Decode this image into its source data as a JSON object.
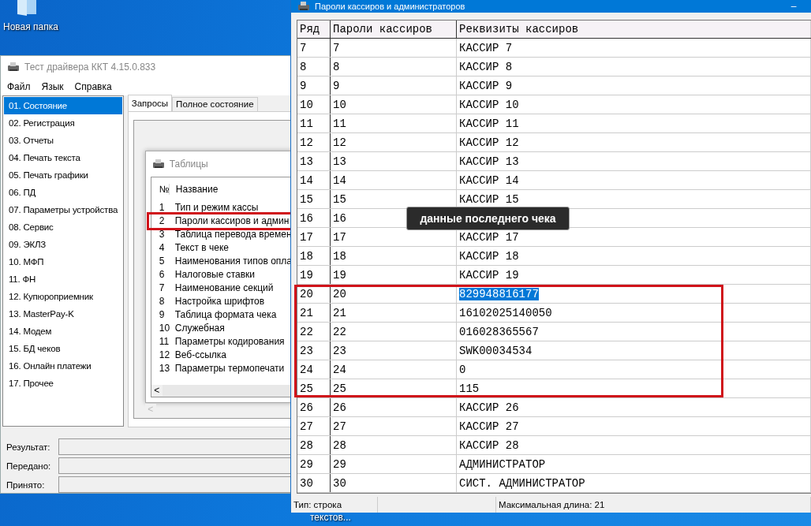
{
  "desktop": {
    "icons": [
      {
        "label": "Новая папка"
      },
      {
        "label": "текстов..."
      }
    ]
  },
  "main_window": {
    "title": "Тест драйвера ККТ 4.15.0.833",
    "menu": [
      "Файл",
      "Язык",
      "Справка"
    ],
    "sidebar": [
      {
        "label": "01. Состояние",
        "selected": true
      },
      {
        "label": "02. Регистрация",
        "selected": false
      },
      {
        "label": "03. Отчеты",
        "selected": false
      },
      {
        "label": "04. Печать текста",
        "selected": false
      },
      {
        "label": "05. Печать графики",
        "selected": false
      },
      {
        "label": "06. ПД",
        "selected": false
      },
      {
        "label": "07. Параметры устройства",
        "selected": false
      },
      {
        "label": "08. Сервис",
        "selected": false
      },
      {
        "label": "09. ЭКЛЗ",
        "selected": false
      },
      {
        "label": "10. МФП",
        "selected": false
      },
      {
        "label": "11. ФН",
        "selected": false
      },
      {
        "label": "12. Купюроприемник",
        "selected": false
      },
      {
        "label": "13. MasterPay-K",
        "selected": false
      },
      {
        "label": "14. Модем",
        "selected": false
      },
      {
        "label": "15. БД чеков",
        "selected": false
      },
      {
        "label": "16. Онлайн платежи",
        "selected": false
      },
      {
        "label": "17. Прочее",
        "selected": false
      }
    ],
    "tabs": [
      {
        "label": "Запросы",
        "selected": true
      },
      {
        "label": "Полное состояние",
        "selected": false
      }
    ],
    "tables_dialog": {
      "title": "Таблицы",
      "columns": [
        "№",
        "Название"
      ],
      "rows": [
        {
          "number": "1",
          "name": "Тип и режим кассы",
          "marked": false
        },
        {
          "number": "2",
          "name": "Пароли кассиров и админ",
          "marked": true
        },
        {
          "number": "3",
          "name": "Таблица перевода времен",
          "marked": false
        },
        {
          "number": "4",
          "name": "Текст в чеке",
          "marked": false
        },
        {
          "number": "5",
          "name": "Наименования типов опла",
          "marked": false
        },
        {
          "number": "6",
          "name": "Налоговые ставки",
          "marked": false
        },
        {
          "number": "7",
          "name": "Наименование секций",
          "marked": false
        },
        {
          "number": "8",
          "name": "Настройка шрифтов",
          "marked": false
        },
        {
          "number": "9",
          "name": "Таблица формата чека",
          "marked": false
        },
        {
          "number": "10",
          "name": "Служебная",
          "marked": false
        },
        {
          "number": "11",
          "name": "Параметры кодирования",
          "marked": false
        },
        {
          "number": "12",
          "name": "Веб-ссылка",
          "marked": false
        },
        {
          "number": "13",
          "name": "Параметры термопечати",
          "marked": false
        }
      ],
      "scroll_arrow": "<"
    },
    "panel_scroll_arrow": "<",
    "status_fields": [
      {
        "label": "Результат:"
      },
      {
        "label": "Передано:"
      },
      {
        "label": "Принято:"
      }
    ]
  },
  "tooltip": {
    "text": "данные последнего чека"
  },
  "passwords_window": {
    "title": "Пароли кассиров и администраторов",
    "minimize": "–",
    "columns": [
      "Ряд",
      "Пароли кассиров",
      "Реквизиты кассиров"
    ],
    "rows": [
      {
        "row": "7",
        "password": "7",
        "details": "КАССИР 7",
        "selected": false,
        "marked": false
      },
      {
        "row": "8",
        "password": "8",
        "details": "КАССИР 8",
        "selected": false,
        "marked": false
      },
      {
        "row": "9",
        "password": "9",
        "details": "КАССИР 9",
        "selected": false,
        "marked": false
      },
      {
        "row": "10",
        "password": "10",
        "details": "КАССИР 10",
        "selected": false,
        "marked": false
      },
      {
        "row": "11",
        "password": "11",
        "details": "КАССИР 11",
        "selected": false,
        "marked": false
      },
      {
        "row": "12",
        "password": "12",
        "details": "КАССИР 12",
        "selected": false,
        "marked": false
      },
      {
        "row": "13",
        "password": "13",
        "details": "КАССИР 13",
        "selected": false,
        "marked": false
      },
      {
        "row": "14",
        "password": "14",
        "details": "КАССИР 14",
        "selected": false,
        "marked": false
      },
      {
        "row": "15",
        "password": "15",
        "details": "КАССИР 15",
        "selected": false,
        "marked": false
      },
      {
        "row": "16",
        "password": "16",
        "marked": false
      },
      {
        "row": "17",
        "password": "17",
        "details": "КАССИР 17",
        "selected": false,
        "marked": false
      },
      {
        "row": "18",
        "password": "18",
        "details": "КАССИР 18",
        "selected": false,
        "marked": false
      },
      {
        "row": "19",
        "password": "19",
        "details": "КАССИР 19",
        "selected": false,
        "marked": false
      },
      {
        "row": "20",
        "password": "20",
        "details": "829948816177",
        "selected": true,
        "marked": true
      },
      {
        "row": "21",
        "password": "21",
        "details": "16102025140050",
        "selected": false,
        "marked": true
      },
      {
        "row": "22",
        "password": "22",
        "details": "016028365567",
        "selected": false,
        "marked": true
      },
      {
        "row": "23",
        "password": "23",
        "details": "SWK00034534",
        "selected": false,
        "marked": true
      },
      {
        "row": "24",
        "password": "24",
        "details": "0",
        "selected": false,
        "marked": true
      },
      {
        "row": "25",
        "password": "25",
        "details": "115",
        "selected": false,
        "marked": true
      },
      {
        "row": "26",
        "password": "26",
        "details": "КАССИР 26",
        "selected": false,
        "marked": false
      },
      {
        "row": "27",
        "password": "27",
        "details": "КАССИР 27",
        "selected": false,
        "marked": false
      },
      {
        "row": "28",
        "password": "28",
        "details": "КАССИР 28",
        "selected": false,
        "marked": false
      },
      {
        "row": "29",
        "password": "29",
        "details": "АДМИНИСТРАТОР",
        "selected": false,
        "marked": false
      },
      {
        "row": "30",
        "password": "30",
        "details": "СИСТ. АДМИНИСТРАТОР",
        "selected": false,
        "marked": false
      }
    ],
    "status_bar": {
      "type": "Тип: строка",
      "max_length": "Максимальная длина: 21"
    }
  }
}
